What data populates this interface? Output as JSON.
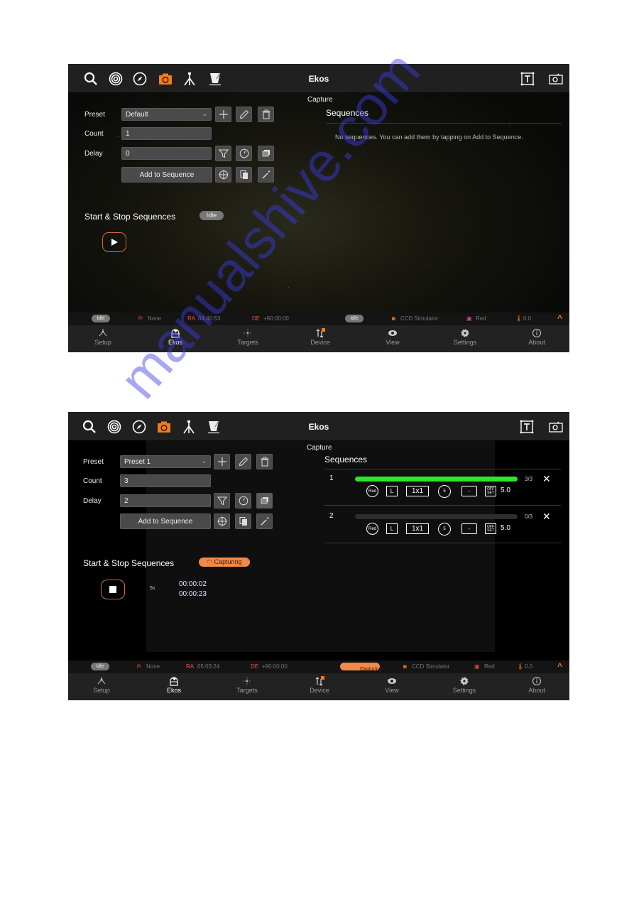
{
  "watermark": "manualshive.com",
  "colors": {
    "accent": "#f07d1a",
    "progress_fill": "#2ee52e",
    "capturing_pill": "#f08a4b",
    "idle_pill": "#777777",
    "status_label": "#e8553a"
  },
  "screens": [
    {
      "header": {
        "title": "Ekos",
        "module_icons": [
          "search-icon",
          "target-icon",
          "compass-icon",
          "camera-icon",
          "tripod-icon",
          "observatory-icon"
        ],
        "active_module": "camera-icon",
        "right_icons": [
          "text-frame-icon",
          "camera-frame-icon"
        ]
      },
      "subtitle": "Capture",
      "form": {
        "preset_label": "Preset",
        "preset_value": "Default",
        "count_label": "Count",
        "count_value": "1",
        "delay_label": "Delay",
        "delay_value": "0",
        "add_button": "Add to Sequence"
      },
      "start_stop": {
        "title": "Start & Stop Sequences",
        "status": "Idle",
        "button": "play"
      },
      "sequences": {
        "title": "Sequences",
        "empty_message": "No sequences. You can add them by tapping on Add to Sequence.",
        "rows": []
      },
      "statusbar": {
        "left_status": "Idle",
        "mount": "None",
        "ra_label": "RA",
        "ra": "04:40:53",
        "de_label": "DE",
        "de": "+90:00:00",
        "right_status": "Idle",
        "camera": "CCD Simulator",
        "filter": "Red",
        "temperature": "0.0"
      }
    },
    {
      "header": {
        "title": "Ekos",
        "module_icons": [
          "search-icon",
          "target-icon",
          "compass-icon",
          "camera-icon",
          "tripod-icon",
          "observatory-icon"
        ],
        "active_module": "camera-icon",
        "right_icons": [
          "text-frame-icon",
          "camera-frame-icon"
        ]
      },
      "subtitle": "Capture",
      "form": {
        "preset_label": "Preset",
        "preset_value": "Preset 1",
        "count_label": "Count",
        "count_value": "3",
        "delay_label": "Delay",
        "delay_value": "2",
        "add_button": "Add to Sequence"
      },
      "start_stop": {
        "title": "Start & Stop Sequences",
        "status": "Capturing",
        "button": "stop",
        "exposure": "5s",
        "elapsed": "00:00:02",
        "remaining": "00:00:23"
      },
      "sequences": {
        "title": "Sequences",
        "rows": [
          {
            "index": "1",
            "progress": 1.0,
            "progress_text": "3/3",
            "type": "Red",
            "filter": "L",
            "binning": "1x1",
            "exposure": "5",
            "frame": "-",
            "offset_label": "OFF SET",
            "offset": "5.0"
          },
          {
            "index": "2",
            "progress": 0.0,
            "progress_text": "0/3",
            "type": "Red",
            "filter": "L",
            "binning": "1x1",
            "exposure": "5",
            "frame": "-",
            "offset_label": "OFF SET",
            "offset": "5.0"
          }
        ]
      },
      "statusbar": {
        "left_status": "Idle",
        "mount": "None",
        "ra_label": "RA",
        "ra": "05:03:24",
        "de_label": "DE",
        "de": "+90:00:00",
        "right_status": "Capturing",
        "camera": "CCD Simulator",
        "filter": "Red",
        "temperature": "0.0"
      }
    }
  ],
  "navbar": {
    "items": [
      {
        "label": "Setup",
        "icon": "setup-icon"
      },
      {
        "label": "Ekos",
        "icon": "ekos-dome-icon",
        "selected": true
      },
      {
        "label": "Targets",
        "icon": "targets-icon"
      },
      {
        "label": "Device",
        "icon": "device-icon",
        "badge": "0"
      },
      {
        "label": "View",
        "icon": "eye-icon"
      },
      {
        "label": "Settings",
        "icon": "gear-icon"
      },
      {
        "label": "About",
        "icon": "info-icon"
      }
    ]
  }
}
